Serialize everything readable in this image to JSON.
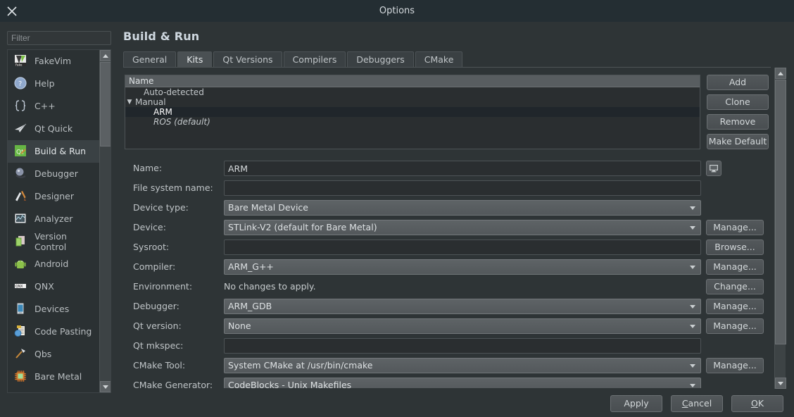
{
  "window": {
    "title": "Options",
    "close_icon": "close-icon"
  },
  "sidebar": {
    "filter_placeholder": "Filter",
    "filter_value": "",
    "items": [
      {
        "label": "FakeVim",
        "icon": "fakevim-icon",
        "selected": false
      },
      {
        "label": "Help",
        "icon": "help-icon",
        "selected": false
      },
      {
        "label": "C++",
        "icon": "cpp-icon",
        "selected": false
      },
      {
        "label": "Qt Quick",
        "icon": "qtquick-icon",
        "selected": false
      },
      {
        "label": "Build & Run",
        "icon": "build-run-icon",
        "selected": true
      },
      {
        "label": "Debugger",
        "icon": "debugger-icon",
        "selected": false
      },
      {
        "label": "Designer",
        "icon": "designer-icon",
        "selected": false
      },
      {
        "label": "Analyzer",
        "icon": "analyzer-icon",
        "selected": false
      },
      {
        "label": "Version Control",
        "icon": "version-control-icon",
        "selected": false
      },
      {
        "label": "Android",
        "icon": "android-icon",
        "selected": false
      },
      {
        "label": "QNX",
        "icon": "qnx-icon",
        "selected": false
      },
      {
        "label": "Devices",
        "icon": "devices-icon",
        "selected": false
      },
      {
        "label": "Code Pasting",
        "icon": "code-pasting-icon",
        "selected": false
      },
      {
        "label": "Qbs",
        "icon": "qbs-icon",
        "selected": false
      },
      {
        "label": "Bare Metal",
        "icon": "bare-metal-icon",
        "selected": false
      }
    ]
  },
  "page": {
    "heading": "Build & Run",
    "tabs": [
      {
        "label": "General",
        "active": false
      },
      {
        "label": "Kits",
        "active": true
      },
      {
        "label": "Qt Versions",
        "active": false
      },
      {
        "label": "Compilers",
        "active": false
      },
      {
        "label": "Debuggers",
        "active": false
      },
      {
        "label": "CMake",
        "active": false
      }
    ]
  },
  "kit_list": {
    "column_header": "Name",
    "rows": [
      {
        "label": "Auto-detected",
        "indent": 1,
        "caret": "",
        "selected": false,
        "italic": false
      },
      {
        "label": "Manual",
        "indent": 0,
        "caret": "▼",
        "selected": false,
        "italic": false
      },
      {
        "label": "ARM",
        "indent": 2,
        "caret": "",
        "selected": true,
        "italic": false
      },
      {
        "label": "ROS (default)",
        "indent": 2,
        "caret": "",
        "selected": false,
        "italic": true
      }
    ]
  },
  "list_actions": [
    {
      "label": "Add"
    },
    {
      "label": "Clone"
    },
    {
      "label": "Remove"
    },
    {
      "label": "Make Default"
    }
  ],
  "form": {
    "rows": [
      {
        "label": "Name:",
        "type": "input",
        "value": "ARM",
        "button": "",
        "icon": "monitor-icon"
      },
      {
        "label": "File system name:",
        "type": "input",
        "value": "",
        "button": "",
        "icon": ""
      },
      {
        "label": "Device type:",
        "type": "combo",
        "value": "Bare Metal Device",
        "button": "",
        "icon": ""
      },
      {
        "label": "Device:",
        "type": "combo",
        "value": "STLink-V2 (default for Bare Metal)",
        "button": "Manage...",
        "icon": ""
      },
      {
        "label": "Sysroot:",
        "type": "input",
        "value": "",
        "button": "Browse...",
        "icon": ""
      },
      {
        "label": "Compiler:",
        "type": "combo",
        "value": "ARM_G++",
        "button": "Manage...",
        "icon": ""
      },
      {
        "label": "Environment:",
        "type": "static",
        "value": "No changes to apply.",
        "button": "Change...",
        "icon": ""
      },
      {
        "label": "Debugger:",
        "type": "combo",
        "value": "ARM_GDB",
        "button": "Manage...",
        "icon": ""
      },
      {
        "label": "Qt version:",
        "type": "combo",
        "value": "None",
        "button": "Manage...",
        "icon": ""
      },
      {
        "label": "Qt mkspec:",
        "type": "input",
        "value": "",
        "button": "",
        "icon": ""
      },
      {
        "label": "CMake Tool:",
        "type": "combo",
        "value": "System CMake at /usr/bin/cmake",
        "button": "Manage...",
        "icon": ""
      },
      {
        "label": "CMake Generator:",
        "type": "combo",
        "value": "CodeBlocks - Unix Makefiles",
        "button": "",
        "icon": ""
      }
    ]
  },
  "dialog_buttons": [
    {
      "label": "Apply",
      "mnemonic": ""
    },
    {
      "label": "Cancel",
      "mnemonic": "C"
    },
    {
      "label": "OK",
      "mnemonic": "O"
    }
  ],
  "colors": {
    "titlebar": "#242e33",
    "window": "#2e3436",
    "selection": "#20262b",
    "heading": "#cfd8e0",
    "combo": "#5a5f62"
  }
}
